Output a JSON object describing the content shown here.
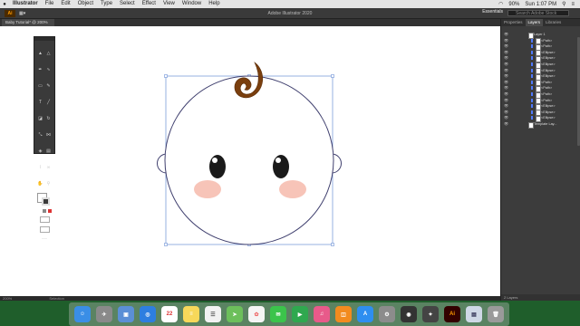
{
  "menubar": {
    "apple": "",
    "app_name": "Illustrator",
    "items": [
      "File",
      "Edit",
      "Object",
      "Type",
      "Select",
      "Effect",
      "View",
      "Window",
      "Help"
    ],
    "battery": "90%",
    "clock": "Sun 1:07 PM"
  },
  "appbar": {
    "logo": "Ai",
    "title": "Adobe Illustrator 2020",
    "workspace": "Essentials",
    "search_placeholder": "Search Adobe Stock"
  },
  "document": {
    "tab_label": "Baby Tutorial* @ 200% (RGB/Preview)",
    "zoom": "200%",
    "status_tool": "Selection"
  },
  "panel": {
    "tabs": [
      "Properties",
      "Layers",
      "Libraries"
    ],
    "active_tab": "Layers",
    "layers": [
      {
        "name": "Layer 1",
        "level": 0
      },
      {
        "name": "<Path>",
        "level": 1
      },
      {
        "name": "<Path>",
        "level": 1
      },
      {
        "name": "<Ellipse>",
        "level": 1
      },
      {
        "name": "<Ellipse>",
        "level": 1
      },
      {
        "name": "<Ellipse>",
        "level": 1
      },
      {
        "name": "<Ellipse>",
        "level": 1
      },
      {
        "name": "<Ellipse>",
        "level": 1
      },
      {
        "name": "<Path>",
        "level": 1
      },
      {
        "name": "<Path>",
        "level": 1
      },
      {
        "name": "<Path>",
        "level": 1
      },
      {
        "name": "<Path>",
        "level": 1
      },
      {
        "name": "<Ellipse>",
        "level": 1
      },
      {
        "name": "<Ellipse>",
        "level": 1
      },
      {
        "name": "<Ellipse>",
        "level": 1
      },
      {
        "name": "Template Lay...",
        "level": 0
      }
    ],
    "footer": "2 Layers"
  },
  "dock": {
    "apps": [
      "Finder",
      "Launchpad",
      "Photos",
      "Safari",
      "Calendar",
      "Notes",
      "Reminders",
      "Maps",
      "Messages",
      "Photo Booth",
      "iTunes",
      "Books",
      "App Store",
      "System Preferences",
      "Camera",
      "Final Cut",
      "Illustrator",
      "Preview",
      "Trash"
    ],
    "calendar_day": "22",
    "illustrator_label": "Ai"
  },
  "colors": {
    "face_stroke": "#3f3f6e",
    "hair": "#7a3f0e",
    "cheek": "#f7c4b8",
    "eye": "#1a1a1a",
    "selection": "#6b8fd6"
  }
}
